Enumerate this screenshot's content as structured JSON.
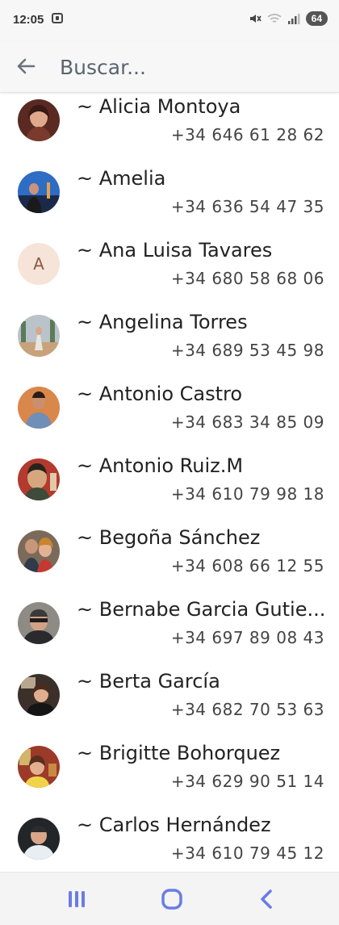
{
  "status": {
    "time": "12:05",
    "battery": "64"
  },
  "search": {
    "placeholder": "Buscar..."
  },
  "contacts": [
    {
      "name": "~ Alicia Montoya",
      "phone": "+34 646 61 28 62"
    },
    {
      "name": "~ Amelia",
      "phone": "+34 636 54 47 35"
    },
    {
      "name": "~ Ana Luisa Tavares",
      "phone": "+34 680 58 68 06",
      "initial": "A"
    },
    {
      "name": "~ Angelina Torres",
      "phone": "+34 689 53 45 98"
    },
    {
      "name": "~ Antonio Castro",
      "phone": "+34 683 34 85 09"
    },
    {
      "name": "~ Antonio Ruiz.M",
      "phone": "+34 610 79 98 18"
    },
    {
      "name": "~ Begoña Sánchez",
      "phone": "+34 608 66 12 55"
    },
    {
      "name": "~ Bernabe Garcia Gutie...",
      "phone": "+34 697 89 08 43"
    },
    {
      "name": "~ Berta García",
      "phone": "+34 682 70 53 63"
    },
    {
      "name": "~ Brigitte Bohorquez",
      "phone": "+34 629 90 51 14"
    },
    {
      "name": "~ Carlos Hernández",
      "phone": "+34 610 79 45 12"
    }
  ],
  "icons": {
    "back": "arrow-left-icon",
    "screenshot": "screenshot-icon",
    "mute": "mute-icon",
    "wifi": "wifi-icon",
    "signal": "signal-icon",
    "recents": "recents-icon",
    "home": "home-icon",
    "nav_back": "chevron-left-icon"
  },
  "colors": {
    "accent": "#5b6ee1",
    "nav_icon": "#6a7de3",
    "initial_bg": "#f6e4d8"
  }
}
